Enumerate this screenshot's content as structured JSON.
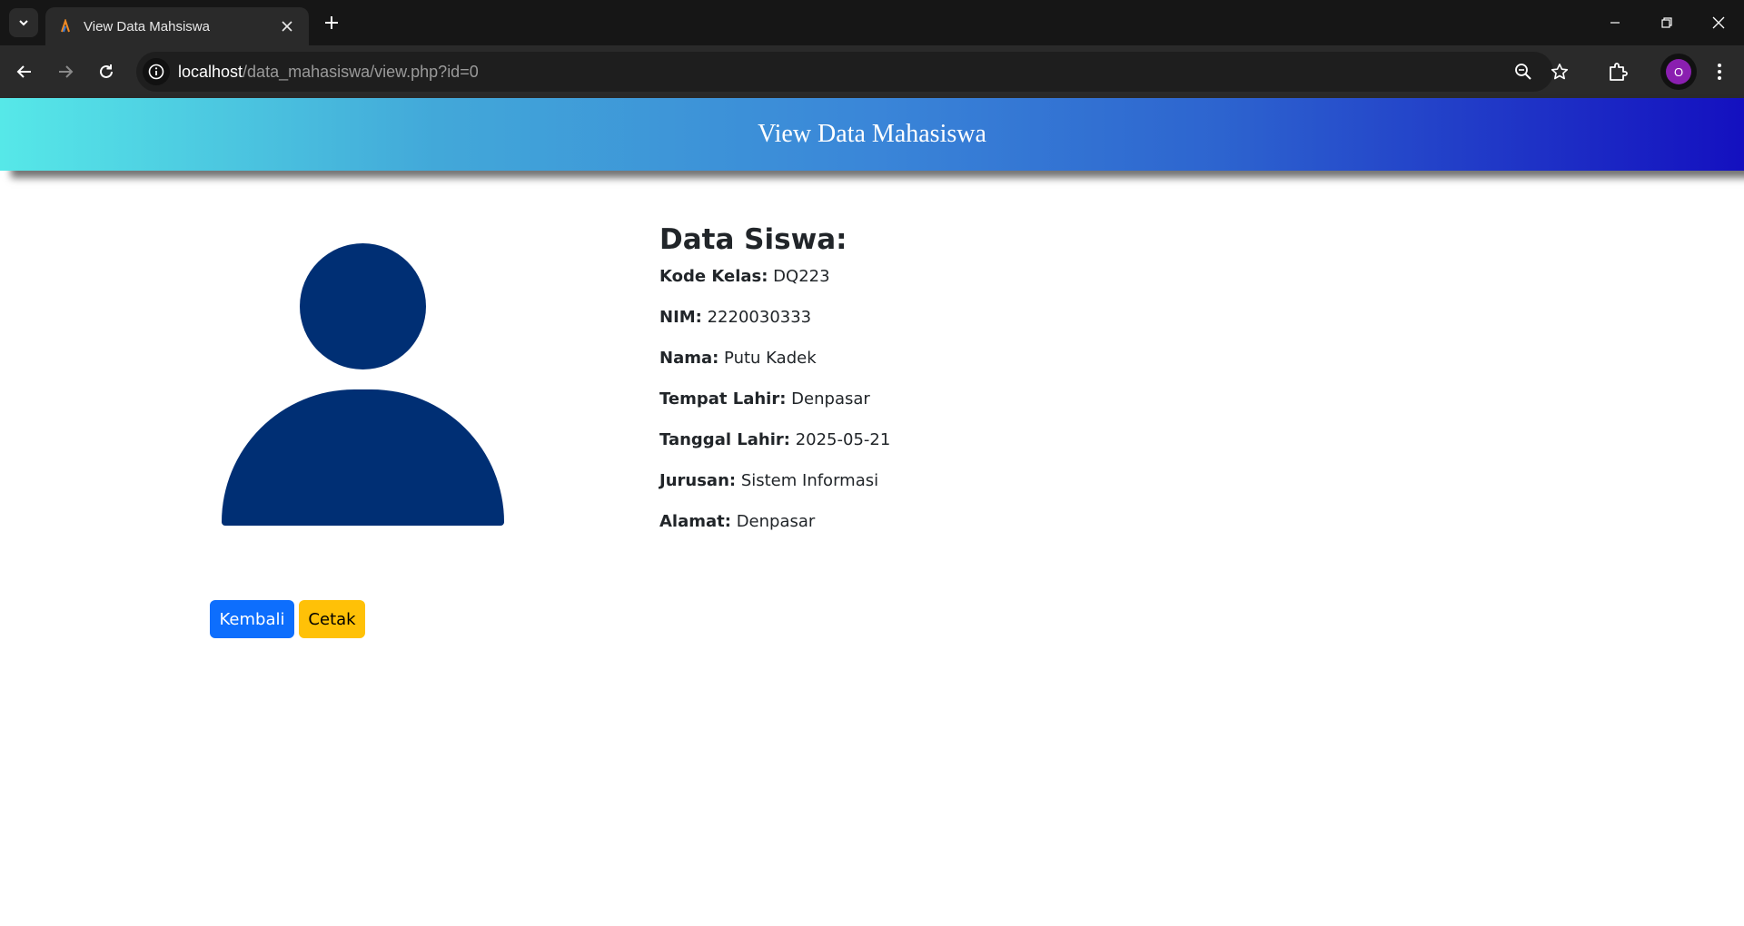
{
  "browser": {
    "tab_title": "View Data Mahsiswa",
    "url_host": "localhost",
    "url_path": "/data_mahasiswa/view.php?id=0",
    "profile_initial": "O"
  },
  "page": {
    "header_title": "View Data Mahasiswa",
    "details_heading": "Data Siswa:",
    "fields": [
      {
        "label": "Kode Kelas:",
        "value": "DQ223"
      },
      {
        "label": "NIM:",
        "value": "2220030333"
      },
      {
        "label": "Nama:",
        "value": "Putu Kadek"
      },
      {
        "label": "Tempat Lahir:",
        "value": "Denpasar"
      },
      {
        "label": "Tanggal Lahir:",
        "value": "2025-05-21"
      },
      {
        "label": "Jurusan:",
        "value": "Sistem Informasi"
      },
      {
        "label": "Alamat:",
        "value": "Denpasar"
      }
    ],
    "buttons": {
      "back_label": "Kembali",
      "print_label": "Cetak"
    }
  },
  "colors": {
    "avatar": "#002f74",
    "primary_button": "#0d6efd",
    "warning_button": "#ffc107"
  }
}
